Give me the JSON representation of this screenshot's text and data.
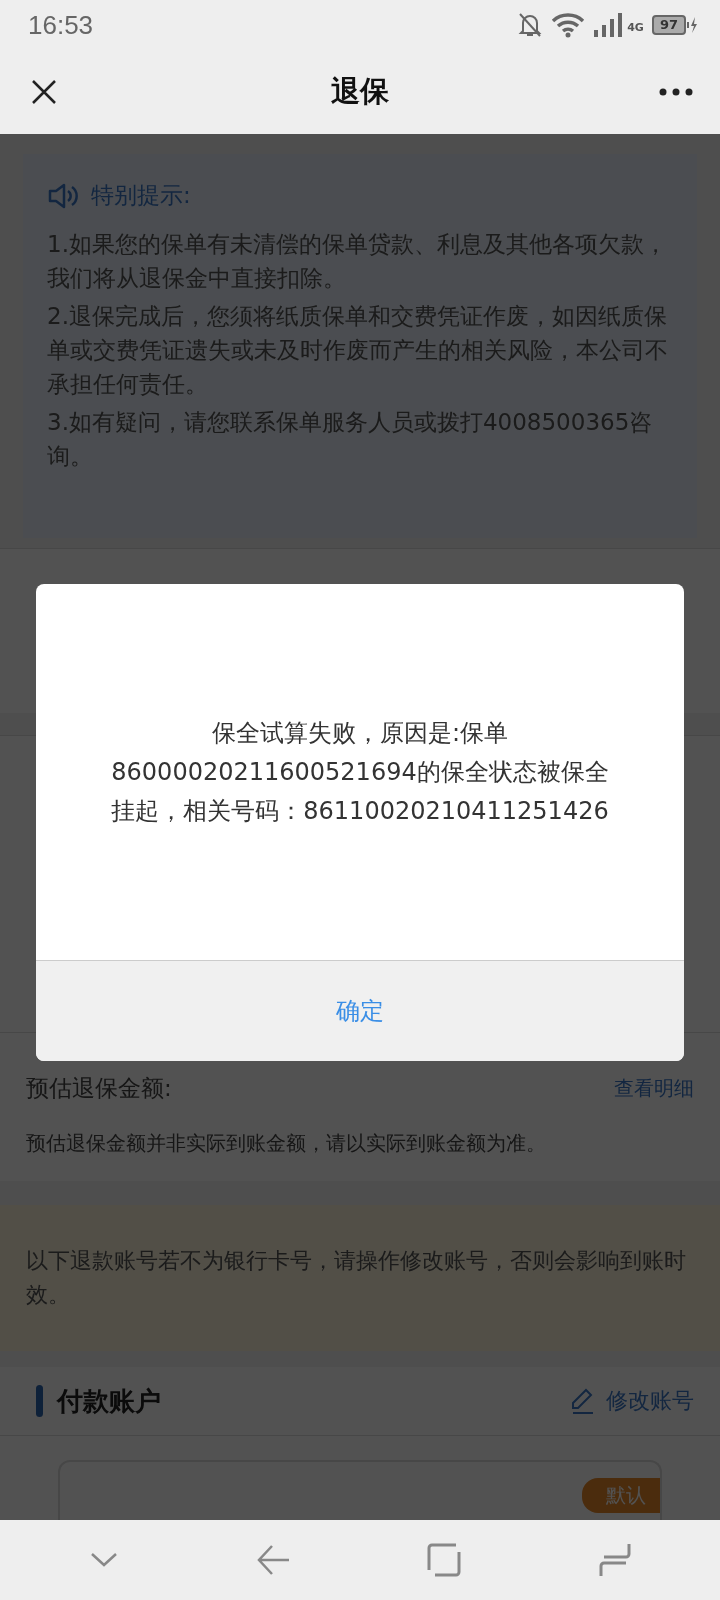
{
  "status_bar": {
    "time": "16:53",
    "network": "4G",
    "battery": "97"
  },
  "header": {
    "title": "退保"
  },
  "notice": {
    "title": "特别提示:",
    "items": [
      "1.如果您的保单有未清偿的保单贷款、利息及其他各项欠款，我们将从退保金中直接扣除。",
      "2.退保完成后，您须将纸质保单和交费凭证作废，如因纸质保单或交费凭证遗失或未及时作废而产生的相关风险，本公司不承担任何责任。",
      "3.如有疑问，请您联系保单服务人员或拨打4008500365咨询。"
    ]
  },
  "estimate": {
    "label": "预估退保金额:",
    "link": "查看明细",
    "note": "预估退保金额并非实际到账金额，请以实际到账金额为准。"
  },
  "refund_notice": {
    "text": "以下退款账号若不为银行卡号，请操作修改账号，否则会影响到账时效。"
  },
  "account": {
    "title": "付款账户",
    "edit": "修改账号",
    "badge": "默认"
  },
  "dialog": {
    "message": "保全试算失败，原因是:保单86000020211600521694的保全状态被保全挂起，相关号码：86110020210411251426",
    "button": "确定"
  }
}
